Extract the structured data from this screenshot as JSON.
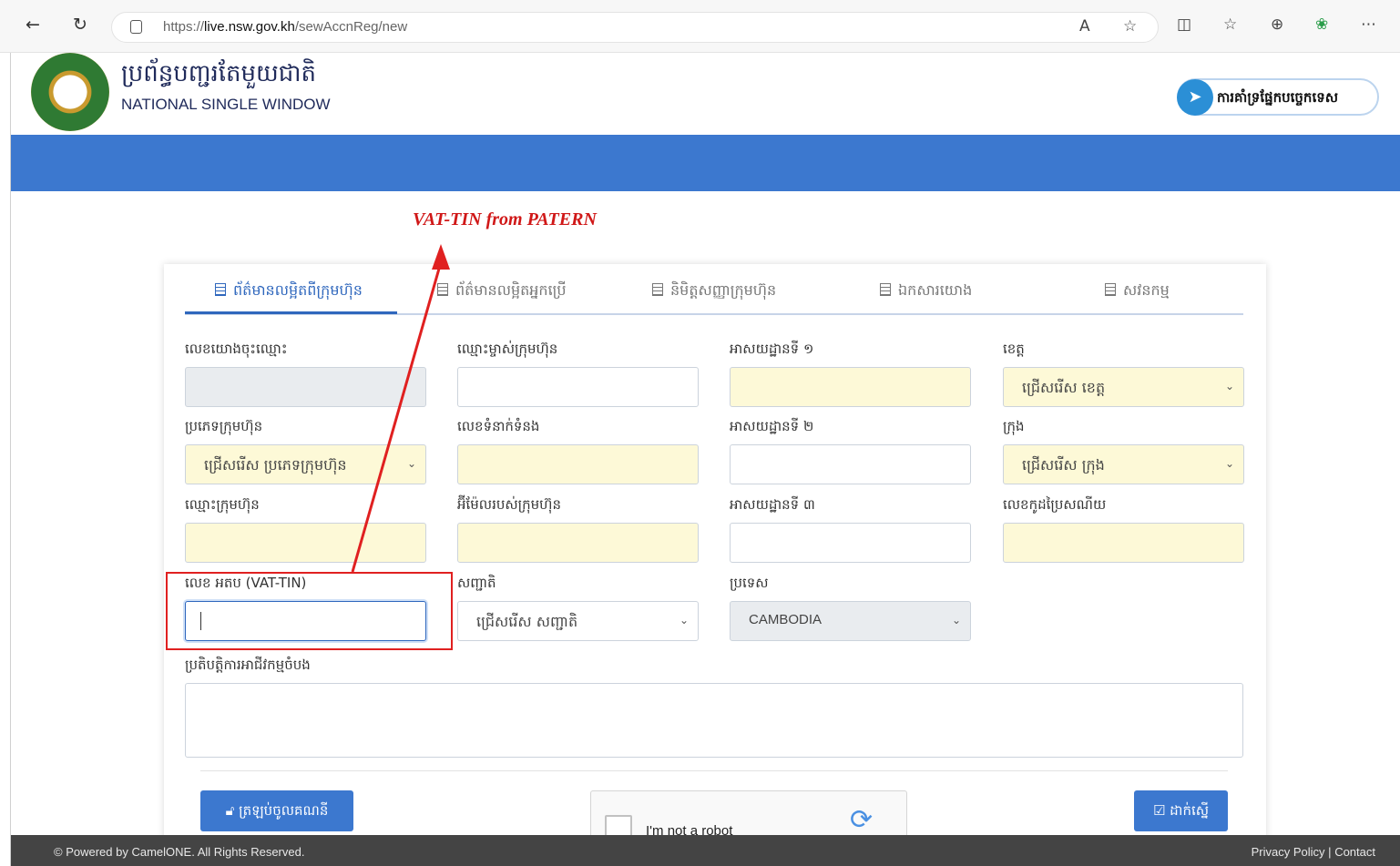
{
  "browser": {
    "url_prefix": "https://",
    "url_domain": "live.nsw.gov.kh",
    "url_path": "/sewAccnReg/new",
    "icons": [
      "back-icon",
      "refresh-icon",
      "read-aloud-icon",
      "favorite-star-icon",
      "split-screen-icon",
      "favorites-icon",
      "collections-icon",
      "copilot-icon",
      "more-icon"
    ]
  },
  "header": {
    "brand_kh": "ប្រព័ន្ធបញ្ជរតែមួយជាតិ",
    "brand_en": "NATIONAL SINGLE WINDOW",
    "support_label": "ការគាំទ្រផ្នែកបច្ចេកទេស"
  },
  "annotation": {
    "title": "VAT-TIN from PATERN"
  },
  "tabs": [
    {
      "label": "ព័ត៌មានលម្អិតពីក្រុមហ៊ុន"
    },
    {
      "label": "ព័ត៌មានលម្អិតអ្នកប្រើ"
    },
    {
      "label": "និមិត្តសញ្ញាក្រុមហ៊ុន"
    },
    {
      "label": "ឯកសារយោង"
    },
    {
      "label": "សវនកម្ម"
    }
  ],
  "form": {
    "ref_label": "លេខយោងចុះឈ្មោះ",
    "owner_label": "ឈ្មោះម្ចាស់ក្រុមហ៊ុន",
    "addr1_label": "អាសយដ្ឋានទី ១",
    "province_label": "ខេត្ត",
    "province_value": "ជ្រើសរើស ខេត្ត",
    "type_label": "ប្រភេទក្រុមហ៊ុន",
    "type_value": "ជ្រើសរើស ប្រភេទក្រុមហ៊ុន",
    "contact_label": "លេខទំនាក់ទំនង",
    "addr2_label": "អាសយដ្ឋានទី ២",
    "city_label": "ក្រុង",
    "city_value": "ជ្រើសរើស ក្រុង",
    "company_label": "ឈ្មោះក្រុមហ៊ុន",
    "email_label": "អ៊ីម៉ែលរបស់ក្រុមហ៊ុន",
    "addr3_label": "អាសយដ្ឋានទី ៣",
    "postal_label": "លេខកូដប្រៃសណីយ",
    "vat_label": "លេខ អតប (VAT-TIN)",
    "nationality_label": "សញ្ជាតិ",
    "nationality_value": "ជ្រើសរើស សញ្ជាតិ",
    "country_label": "ប្រទេស",
    "country_value": "CAMBODIA",
    "business_label": "ប្រតិបត្តិការអាជីវកម្មចំបង"
  },
  "actions": {
    "back_label": "ត្រឡប់ចូលគណនី",
    "submit_label": "ដាក់ស្នើ",
    "captcha_label": "I'm not a robot"
  },
  "footer": {
    "copyright": "© Powered by CamelONE. All Rights Reserved.",
    "privacy": "Privacy Policy",
    "separator": "|",
    "contact": "Contact"
  },
  "colors": {
    "primary": "#3c78cf",
    "required_bg": "#fdf9d7",
    "annotation_red": "#e02020"
  }
}
